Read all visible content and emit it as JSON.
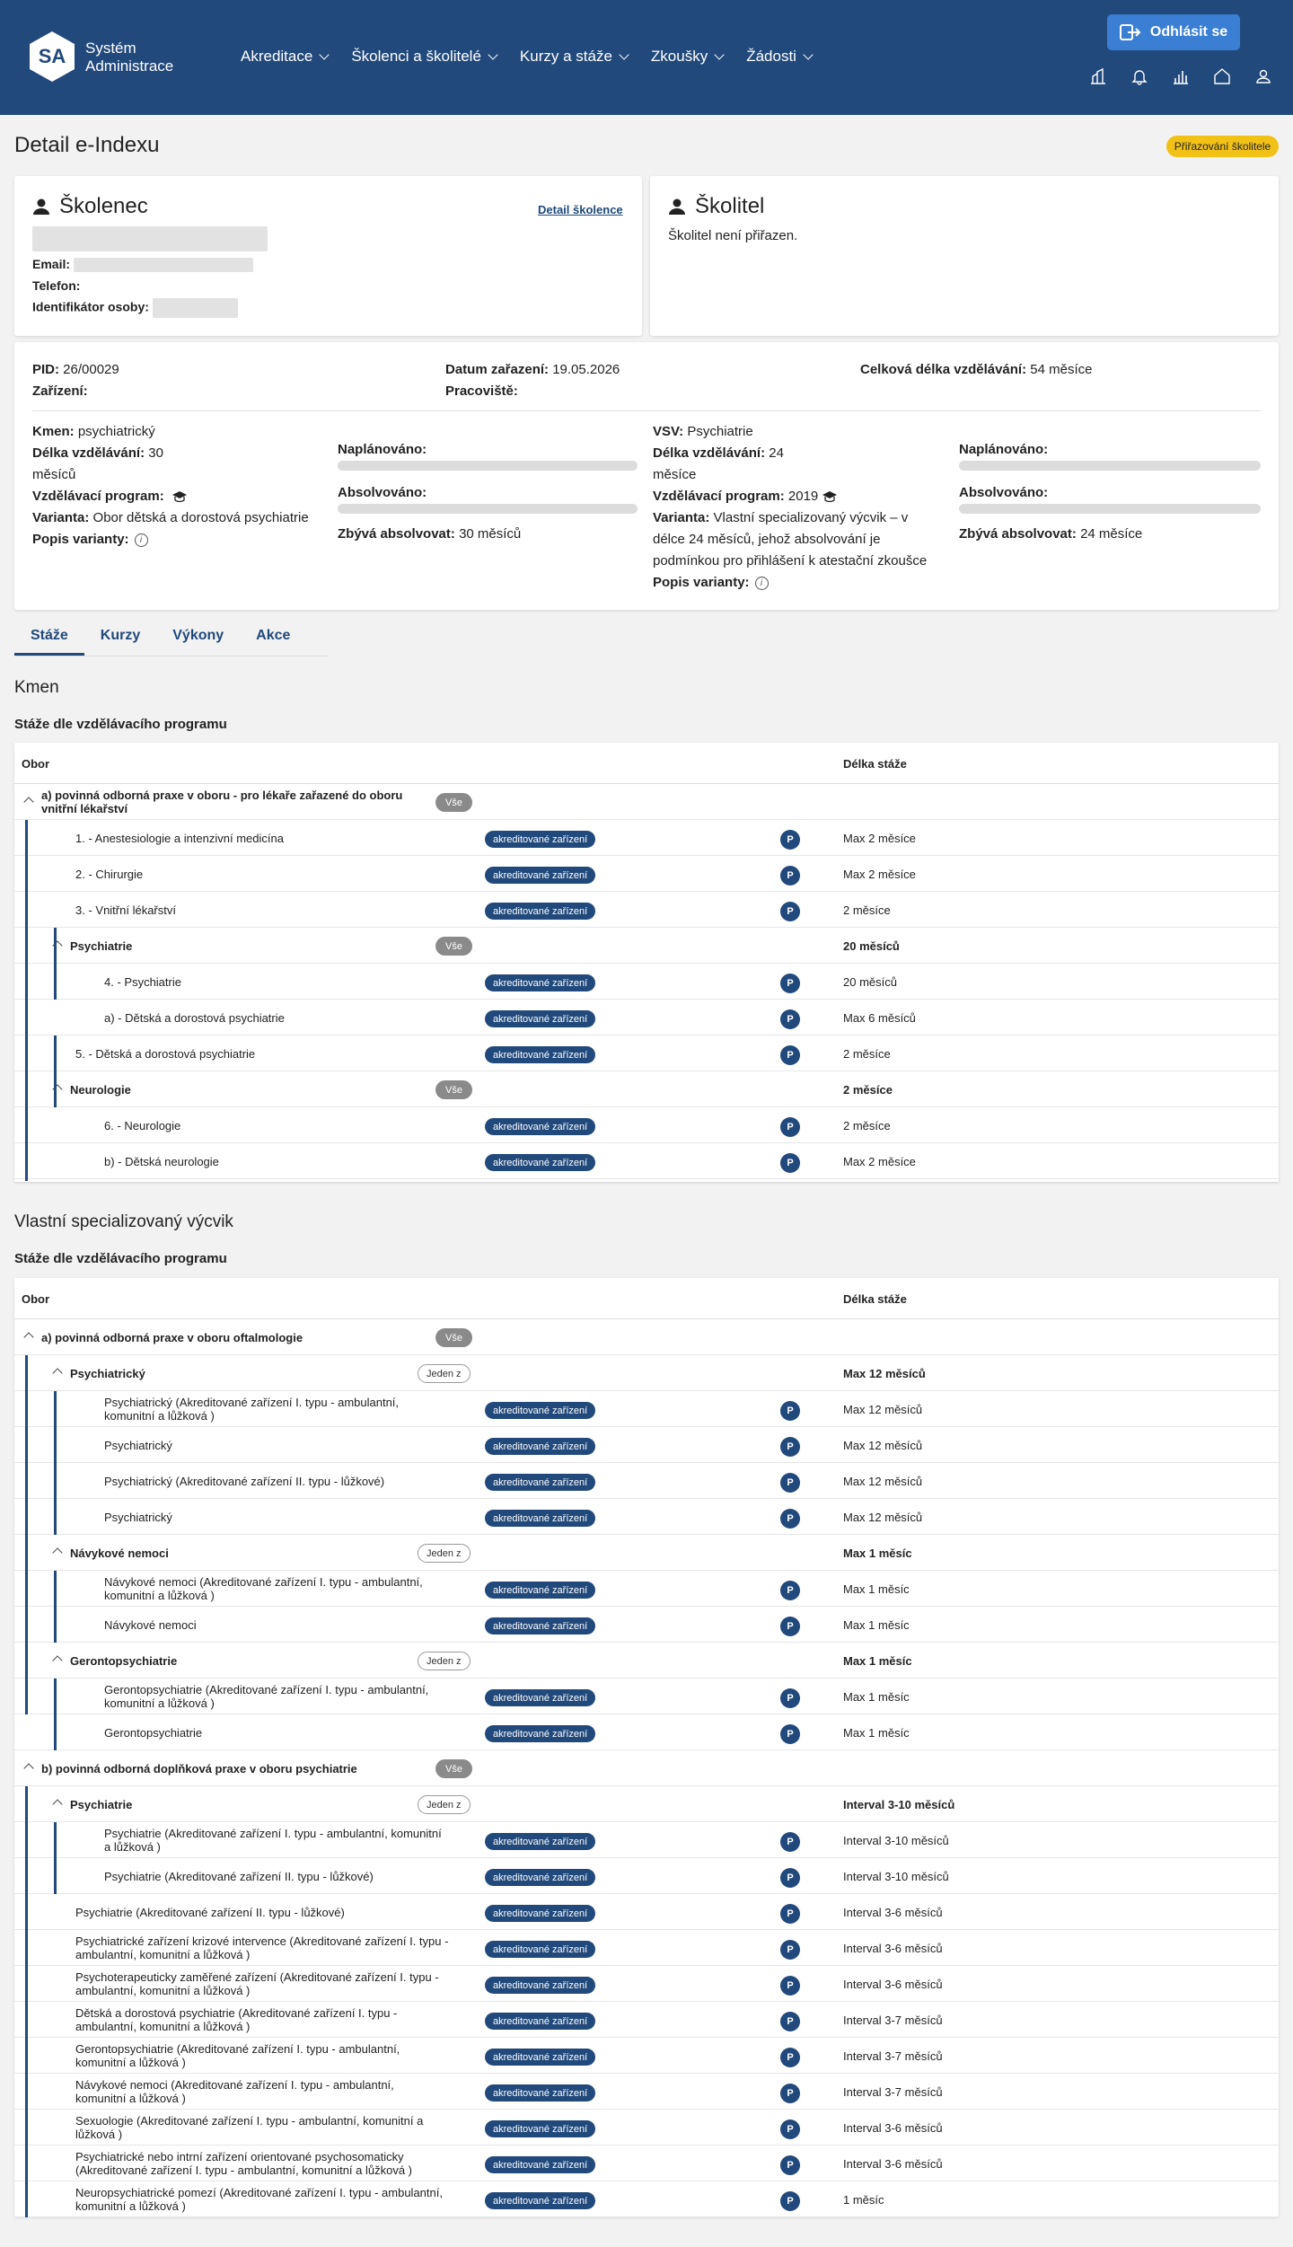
{
  "header": {
    "logo_initials": "SA",
    "logo_line1": "Systém",
    "logo_line2": "Administrace",
    "nav": [
      "Akreditace",
      "Školenci a školitelé",
      "Kurzy a stáže",
      "Zkoušky",
      "Žádosti"
    ],
    "logout_label": "Odhlásit se",
    "icons": [
      "building-chart-icon",
      "bell-icon",
      "bar-chart-icon",
      "home-icon",
      "user-icon"
    ]
  },
  "page": {
    "title": "Detail e-Indexu",
    "status_badge": "Přiřazování školitele"
  },
  "trainee": {
    "heading": "Školenec",
    "detail_link": "Detail školence",
    "email_label": "Email:",
    "phone_label": "Telefon:",
    "id_label": "Identifikátor osoby:"
  },
  "trainer": {
    "heading": "Školitel",
    "text": "Školitel není přiřazen."
  },
  "info": {
    "pid_label": "PID:",
    "pid": "26/00029",
    "date_label": "Datum zařazení:",
    "date": "19.05.2026",
    "total_label": "Celková délka vzdělávání:",
    "total": "54 měsíce",
    "facility_label": "Zařízení:",
    "workplace_label": "Pracoviště:",
    "kmen_label": "Kmen:",
    "kmen": "psychiatrický",
    "kmen_len_label": "Délka vzdělávání:",
    "kmen_len_a": "30",
    "kmen_len_b": "měsíců",
    "kmen_prog_label": "Vzdělávací program:",
    "kmen_var_label": "Varianta:",
    "kmen_var": "Obor dětská a dorostová psychiatrie",
    "kmen_desc_label": "Popis varianty:",
    "planned_label": "Naplánováno:",
    "completed_label": "Absolvováno:",
    "kmen_remaining_label": "Zbývá absolvovat:",
    "kmen_remaining": "30 měsíců",
    "vsv_label": "VSV:",
    "vsv": "Psychiatrie",
    "vsv_len_label": "Délka vzdělávání:",
    "vsv_len_a": "24",
    "vsv_len_b": "měsíce",
    "vsv_prog_label": "Vzdělávací program:",
    "vsv_prog": "2019",
    "vsv_var_label": "Varianta:",
    "vsv_var_1": "Vlastní specializovaný výcvik – v",
    "vsv_var_2": "délce 24 měsíců, jehož absolvování je",
    "vsv_var_3": "podmínkou pro přihlášení k atestační zkoušce",
    "vsv_desc_label": "Popis varianty:",
    "vsv_remaining_label": "Zbývá absolvovat:",
    "vsv_remaining": "24 měsíce",
    "kmen_planned_fraction": 0,
    "kmen_completed_fraction": 0,
    "vsv_planned_fraction": 0,
    "vsv_completed_fraction": 0
  },
  "tabs": [
    "Stáže",
    "Kurzy",
    "Výkony",
    "Akce"
  ],
  "labels": {
    "col_obor": "Obor",
    "col_len": "Délka stáže",
    "acc": "akreditované zařízení",
    "p": "P",
    "all": "Vše",
    "one_of": "Jeden z"
  },
  "kmen": {
    "heading": "Kmen",
    "subheading": "Stáže dle vzdělávacího programu",
    "g1_name_1": "a) povinná odborná praxe v oboru - pro lékaře zařazené do oboru",
    "g1_name_2": "vnitřní lékařství",
    "rows": [
      {
        "name": "1. - Anestesiologie a intenzivní medicína",
        "len": "Max 2 měsíce"
      },
      {
        "name": "2. - Chirurgie",
        "len": "Max 2 měsíce"
      },
      {
        "name": "3. - Vnitřní lékařství",
        "len": "2 měsíce"
      },
      {
        "name": "Psychiatrie",
        "len": "20 měsíců"
      },
      {
        "name": "4. - Psychiatrie",
        "len": "20 měsíců"
      },
      {
        "name": "a) - Dětská a dorostová psychiatrie",
        "len": "Max 6 měsíců"
      },
      {
        "name": "5. - Dětská a dorostová psychiatrie",
        "len": "2 měsíce"
      },
      {
        "name": "Neurologie",
        "len": "2 měsíce"
      },
      {
        "name": "6. - Neurologie",
        "len": "2 měsíce"
      },
      {
        "name": "b) - Dětská neurologie",
        "len": "Max 2 měsíce"
      }
    ]
  },
  "vsv": {
    "heading": "Vlastní specializovaný výcvik",
    "subheading": "Stáže dle vzdělávacího programu",
    "g1_name": "a) povinná odborná praxe v oboru oftalmologie",
    "g2_name": "b) povinná odborná doplňková praxe v oboru psychiatrie",
    "rows": [
      {
        "name": "Psychiatrický",
        "len": "Max 12 měsíců"
      },
      {
        "name": "Psychiatrický (Akreditované zařízení I. typu - ambulantní,",
        "name2": "komunitní a lůžková )",
        "len": "Max 12 měsíců"
      },
      {
        "name": "Psychiatrický",
        "len": "Max 12 měsíců"
      },
      {
        "name": "Psychiatrický (Akreditované zařízení II. typu - lůžkové)",
        "len": "Max 12 měsíců"
      },
      {
        "name": "Psychiatrický",
        "len": "Max 12 měsíců"
      },
      {
        "name": "Návykové nemoci",
        "len": "Max 1 měsíc"
      },
      {
        "name": "Návykové nemoci (Akreditované zařízení I. typu - ambulantní,",
        "name2": "komunitní a lůžková )",
        "len": "Max 1 měsíc"
      },
      {
        "name": "Návykové nemoci",
        "len": "Max 1 měsíc"
      },
      {
        "name": "Gerontopsychiatrie",
        "len": "Max 1 měsíc"
      },
      {
        "name": "Gerontopsychiatrie (Akreditované zařízení I. typu - ambulantní,",
        "name2": "komunitní a lůžková )",
        "len": "Max 1 měsíc"
      },
      {
        "name": "Gerontopsychiatrie",
        "len": "Max 1 měsíc"
      },
      {
        "name": "Psychiatrie",
        "len": "Interval 3-10 měsíců"
      },
      {
        "name": "Psychiatrie (Akreditované zařízení I. typu - ambulantní, komunitní",
        "name2": "a lůžková )",
        "len": "Interval 3-10 měsíců"
      },
      {
        "name": "Psychiatrie (Akreditované zařízení II. typu - lůžkové)",
        "len": "Interval 3-10 měsíců"
      },
      {
        "name": "Psychiatrie (Akreditované zařízení II. typu - lůžkové)",
        "len": "Interval 3-6 měsíců"
      },
      {
        "name": "Psychiatrické zařízení krizové intervence (Akreditované zařízení I. typu -",
        "name2": "ambulantní, komunitní a lůžková )",
        "len": "Interval 3-6 měsíců"
      },
      {
        "name": "Psychoterapeuticky zaměřené zařízení (Akreditované zařízení I. typu -",
        "name2": "ambulantní, komunitní a lůžková )",
        "len": "Interval 3-6 měsíců"
      },
      {
        "name": "Dětská a dorostová psychiatrie (Akreditované zařízení I. typu -",
        "name2": "ambulantní, komunitní a lůžková )",
        "len": "Interval 3-7 měsíců"
      },
      {
        "name": "Gerontopsychiatrie (Akreditované zařízení I. typu - ambulantní,",
        "name2": "komunitní a lůžková )",
        "len": "Interval 3-7 měsíců"
      },
      {
        "name": "Návykové nemoci (Akreditované zařízení I. typu - ambulantní,",
        "name2": "komunitní a lůžková )",
        "len": "Interval 3-7 měsíců"
      },
      {
        "name": "Sexuologie (Akreditované zařízení I. typu - ambulantní, komunitní a",
        "name2": "lůžková )",
        "len": "Interval 3-6 měsíců"
      },
      {
        "name": "Psychiatrické nebo intrní zařízení orientované psychosomaticky",
        "name2": "(Akreditované zařízení I. typu - ambulantní, komunitní a lůžková )",
        "len": "Interval 3-6 měsíců"
      },
      {
        "name": "Neuropsychiatrické pomezí (Akreditované zařízení I. typu - ambulantní,",
        "name2": "komunitní a lůžková )",
        "len": "1 měsíc"
      }
    ]
  }
}
